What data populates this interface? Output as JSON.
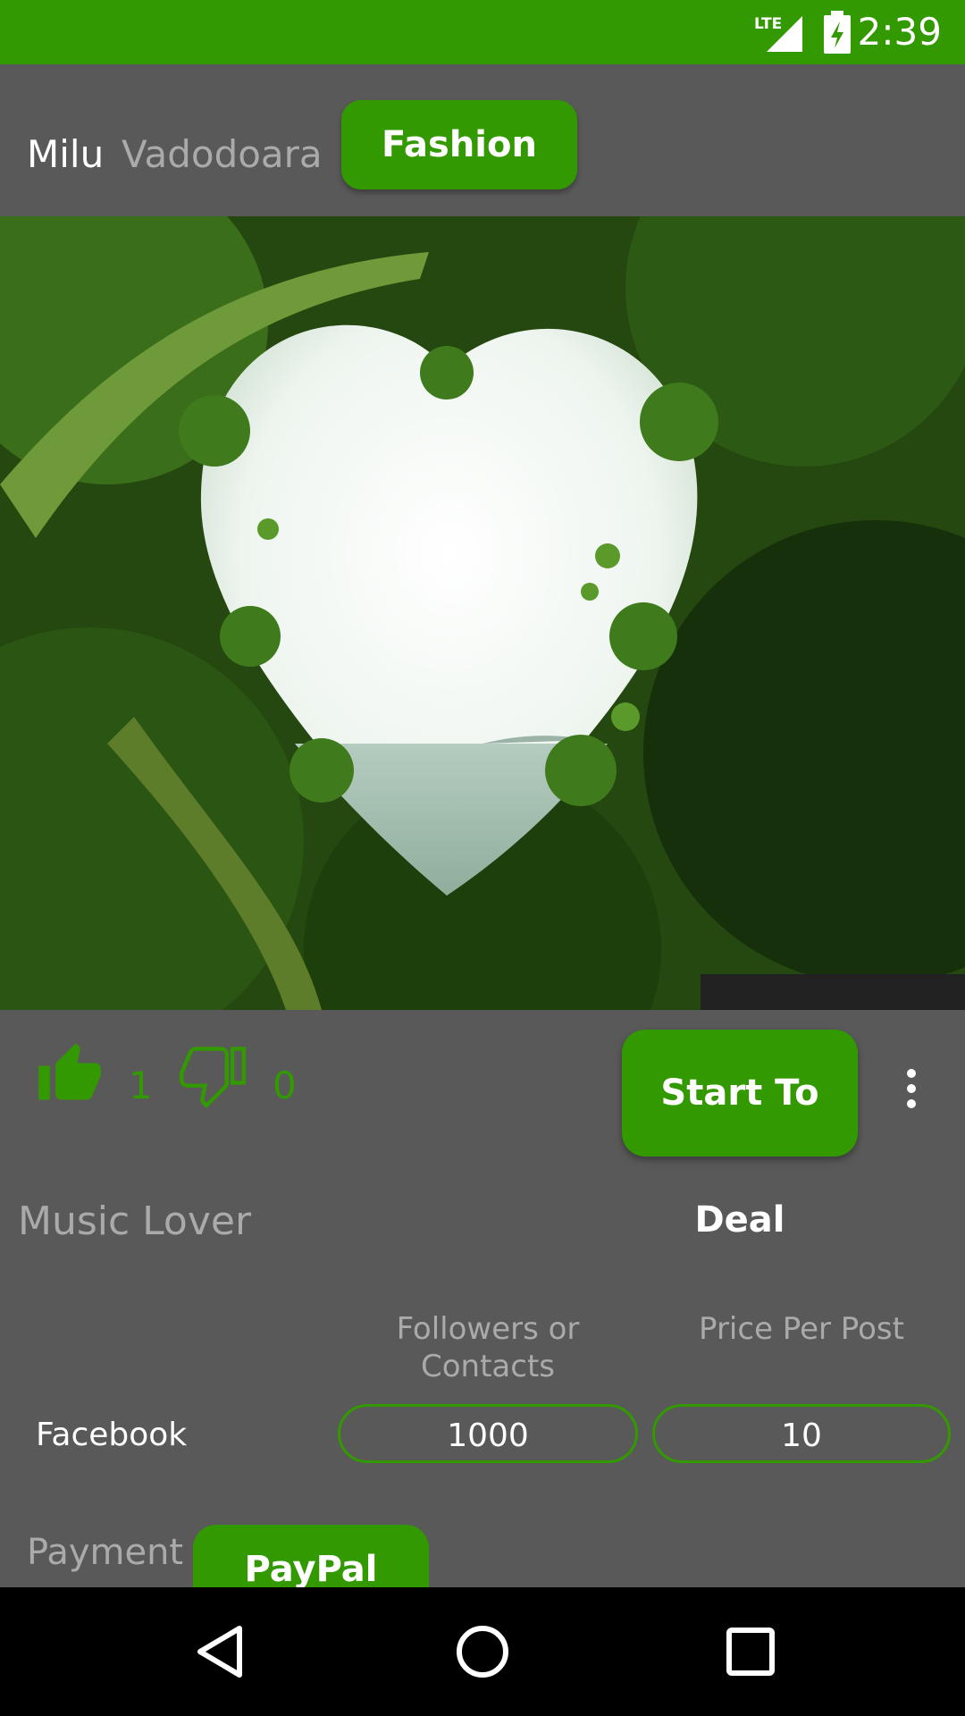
{
  "status_bar": {
    "network": "LTE",
    "time": "2:39"
  },
  "header": {
    "user_name": "Milu",
    "city": "Vadodoara",
    "category": "Fashion"
  },
  "post": {
    "image_desc_icon": "heart-foliage-image",
    "likes": "1",
    "dislikes": "0",
    "deal_button": "Start To Deal",
    "bio": "Music Lover"
  },
  "pricing": {
    "headers": {
      "followers": "Followers or Contacts",
      "price": "Price Per Post"
    },
    "rows": [
      {
        "platform": "Facebook",
        "followers": "1000",
        "price": "10"
      }
    ]
  },
  "payment": {
    "label": "Payment",
    "method": "PayPal"
  },
  "colors": {
    "accent": "#339900",
    "background": "#595959"
  }
}
